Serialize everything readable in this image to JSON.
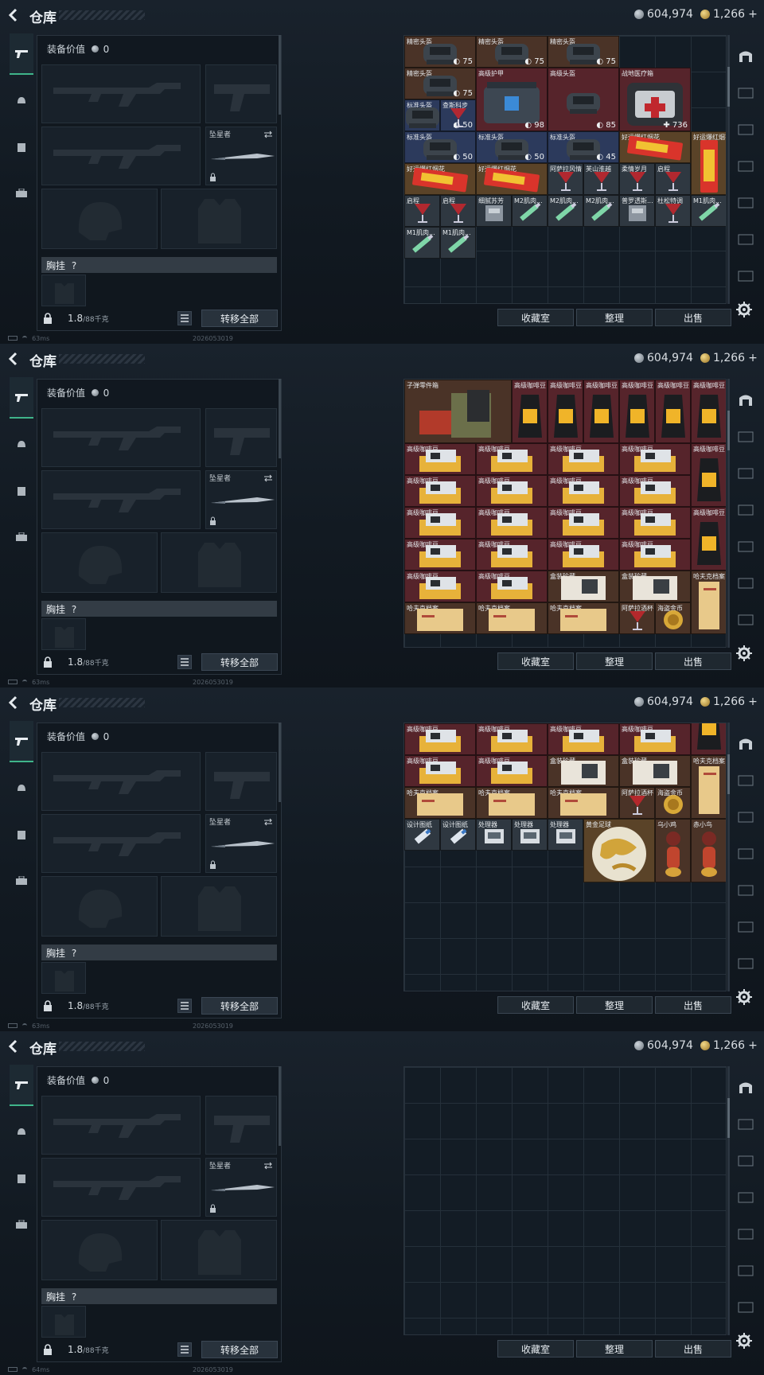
{
  "topbar": {
    "title": "仓库",
    "silver": "604,974",
    "gold": "1,266",
    "plus": "+"
  },
  "equip": {
    "value_label": "装备价值",
    "value": "0",
    "knife_label": "坠星者",
    "chest_label": "胸挂",
    "chest_q": "?",
    "weight": "1.8",
    "capacity": "/88千克",
    "transfer": "转移全部"
  },
  "buttons": {
    "collection": "收藏室",
    "sort": "整理",
    "sell": "出售"
  },
  "status": [
    {
      "ping": "63ms",
      "build": "2026053019"
    },
    {
      "ping": "63ms",
      "build": "2026053019"
    },
    {
      "ping": "63ms",
      "build": "2026053019"
    },
    {
      "ping": "64ms",
      "build": "2026053019"
    }
  ],
  "items": {
    "precise_helmet": "精密头盔",
    "high_armor": "高级护甲",
    "high_helmet": "高级头盔",
    "field_medkit": "战地医疗箱",
    "std_helmet": "标准头盔",
    "qinglu_sprint": "查斯科步",
    "good_cigs": "好运爆红烟花",
    "wine_recipe": "阿萨拉风情",
    "mountain_wine": "芙山淮越",
    "love_years": "柔情岁月",
    "encounter": "启程",
    "fine_grind": "细腻苏芳",
    "m2_muscle": "M2肌肉...",
    "pvc_tape": "普罗透斯...",
    "cocktail": "杜松特调",
    "m1_muscle": "M1肌肉...",
    "ammo_parts": "子弹零件箱",
    "coffee": "高级咖啡豆",
    "box": "盒装珍藏",
    "hafuk_file": "哈夫克档案",
    "toast_cup": "阿萨拉酒杯",
    "sea_coin": "海盗金币",
    "design_blueprint": "设计图纸",
    "processor": "处理器",
    "gold_football": "黄金足球",
    "chick": "乌小鸡",
    "red_figure": "赤小鸟",
    "dur75": "75",
    "dur50": "50",
    "dur98": "98",
    "dur85": "85",
    "dur45": "45",
    "dur736": "736"
  }
}
